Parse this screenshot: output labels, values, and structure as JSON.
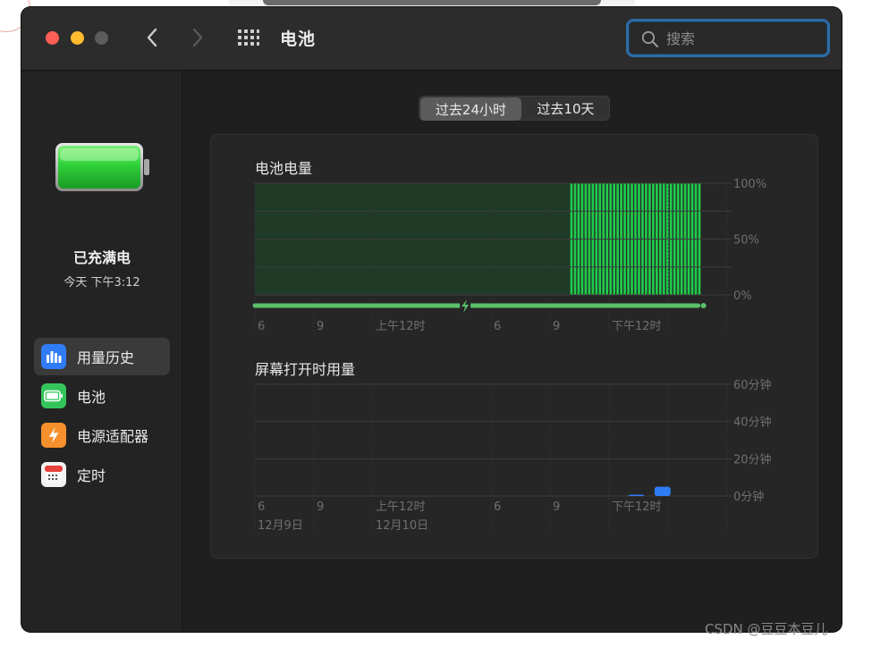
{
  "window": {
    "title": "电池"
  },
  "search": {
    "placeholder": "搜索"
  },
  "sidebar": {
    "status": "已充满电",
    "time": "今天 下午3:12",
    "items": [
      {
        "label": "用量历史",
        "icon": "bar-chart-icon",
        "active": true
      },
      {
        "label": "电池",
        "icon": "battery-icon",
        "active": false
      },
      {
        "label": "电源适配器",
        "icon": "lightning-bolt-icon",
        "active": false
      },
      {
        "label": "定时",
        "icon": "calendar-icon",
        "active": false
      }
    ]
  },
  "range_tabs": [
    {
      "label": "过去24小时",
      "active": true
    },
    {
      "label": "过去10天",
      "active": false
    }
  ],
  "chart_data": [
    {
      "type": "bar",
      "title": "电池电量",
      "x_tick_labels": [
        "6",
        "9",
        "上午12时",
        "6",
        "9",
        "下午12时"
      ],
      "y_tick_labels": [
        "100%",
        "50%",
        "0%"
      ],
      "ylim": [
        0,
        100
      ],
      "segments": [
        {
          "start_hour": 0,
          "end_hour": 12,
          "value": 100,
          "style": "flat"
        },
        {
          "start_hour": 12,
          "end_hour": 17,
          "value": 100,
          "style": "bars"
        }
      ],
      "charging_timeline": {
        "start_hour": 0,
        "end_hour": 17,
        "bolt_hour": 8
      },
      "hours_total": 18,
      "colors": {
        "fill_dark": "#1f3a27",
        "bars": "#1fcc4c",
        "timeline": "#5cc06c"
      }
    },
    {
      "type": "bar",
      "title": "屏幕打开时用量",
      "x_tick_labels": [
        "6",
        "9",
        "上午12时",
        "6",
        "9",
        "下午12时"
      ],
      "date_labels": [
        "12月9日",
        "12月10日"
      ],
      "y_tick_labels": [
        "60分钟",
        "40分钟",
        "20分钟",
        "0分钟"
      ],
      "ylim": [
        0,
        60
      ],
      "values": [
        {
          "hour": 14,
          "minutes": 0.5
        },
        {
          "hour": 15,
          "minutes": 5
        }
      ],
      "hours_total": 18,
      "colors": {
        "bars": "#2f7cf6"
      }
    }
  ],
  "watermark": "CSDN @豆豆本豆儿"
}
